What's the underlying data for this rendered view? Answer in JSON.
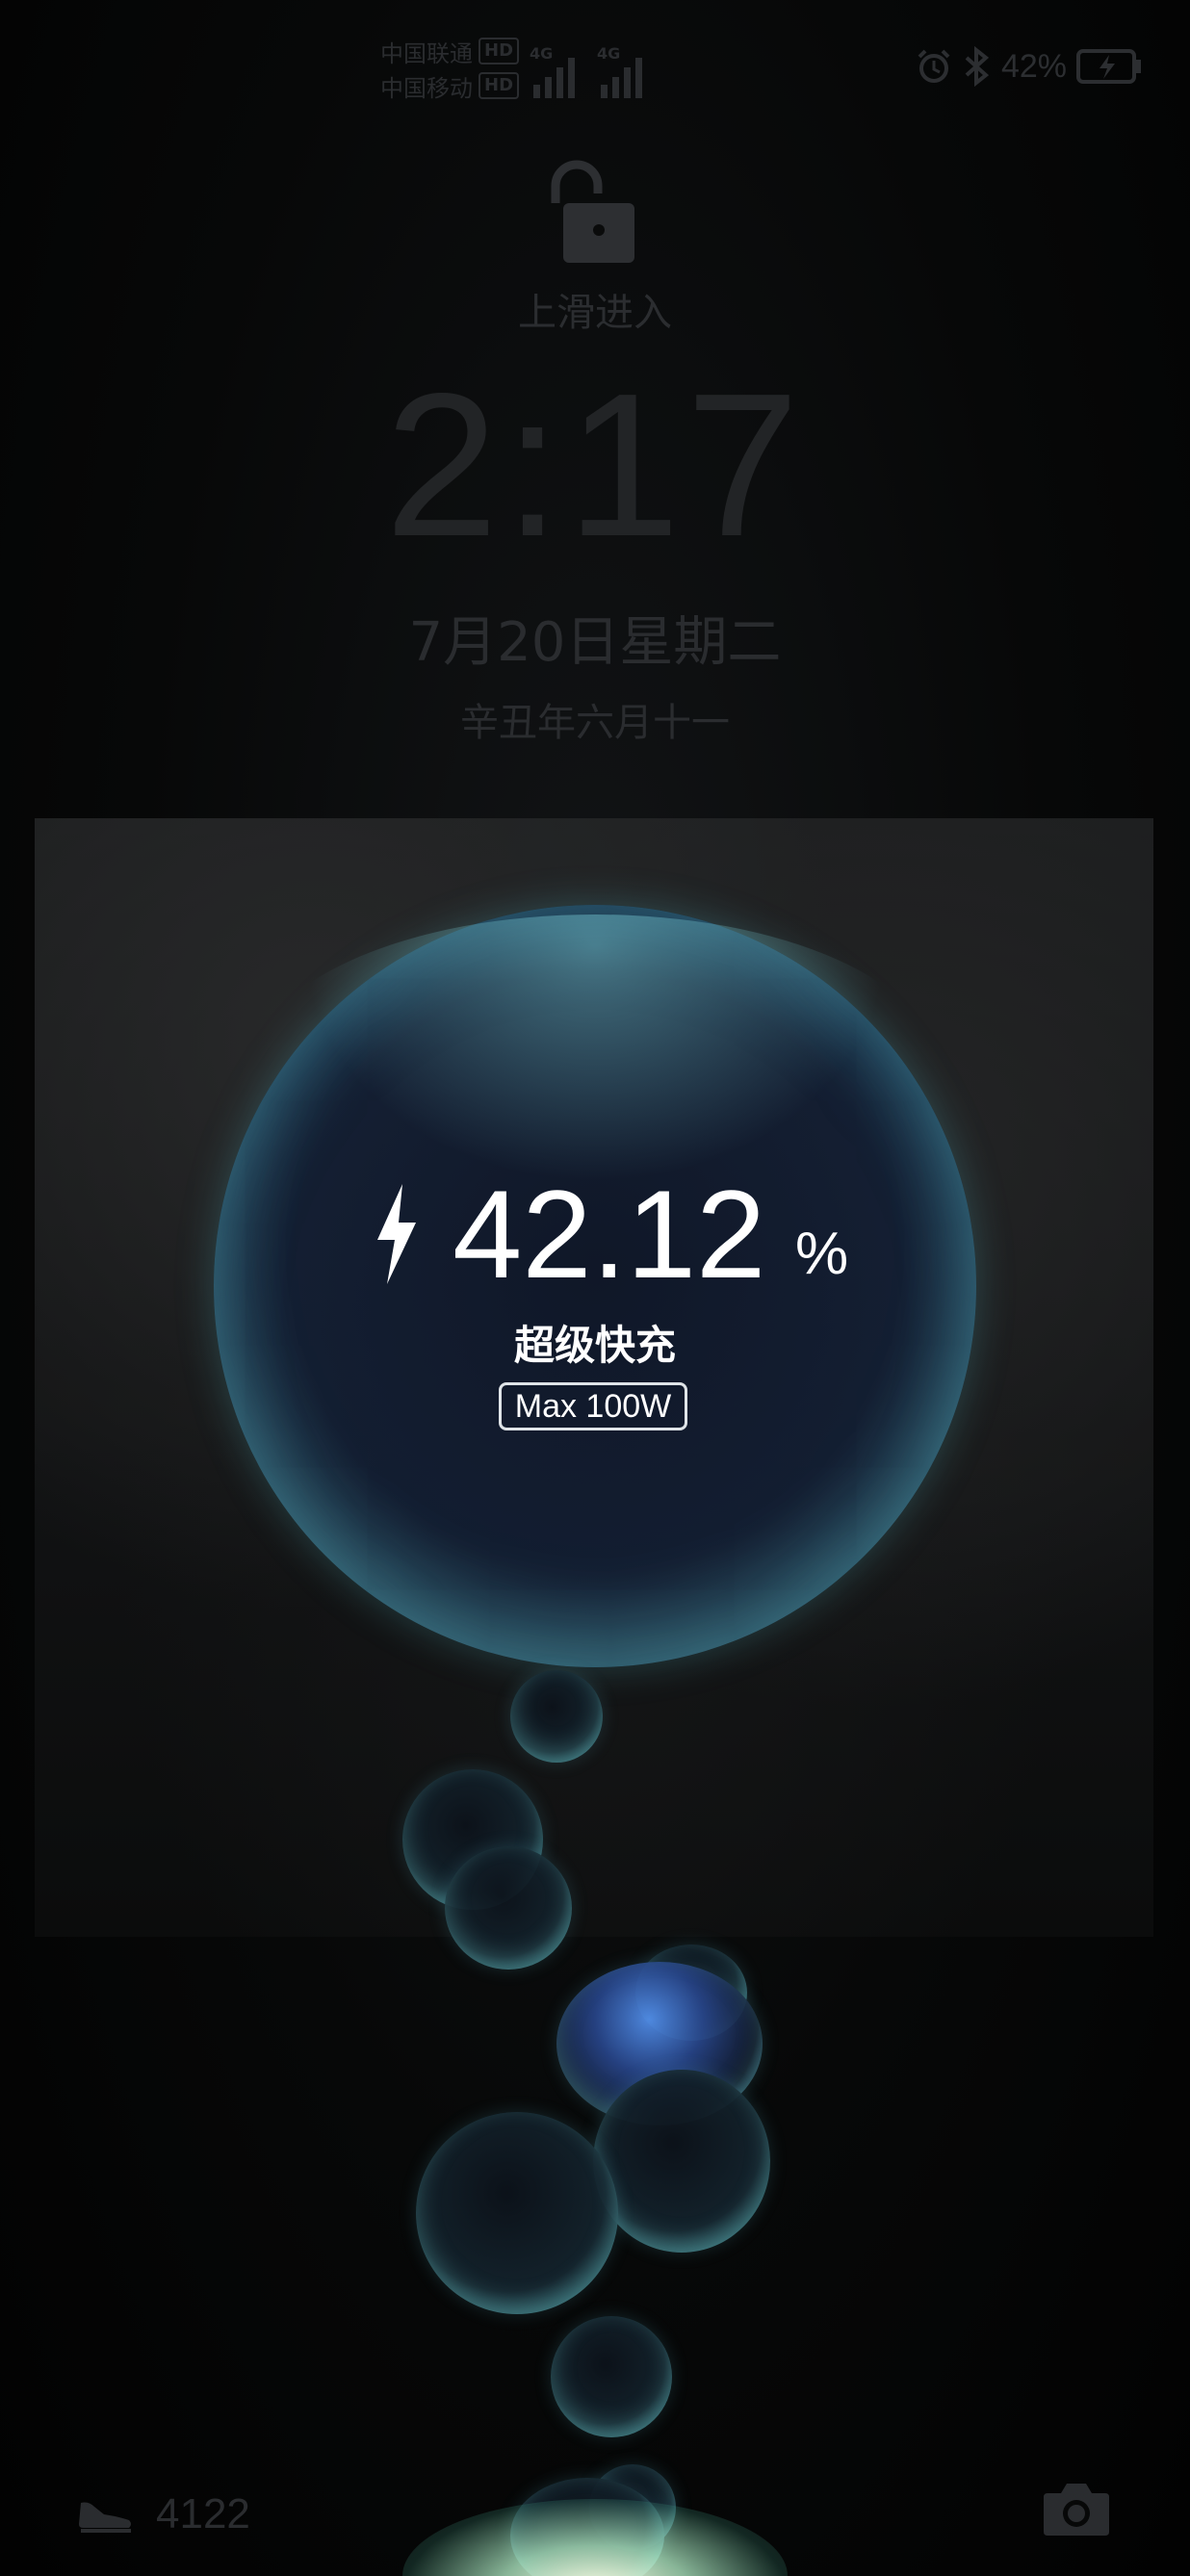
{
  "status_bar": {
    "carrier_1": "中国联通",
    "carrier_2": "中国移动",
    "hd_label": "HD",
    "network_1": "4G",
    "network_2": "4G",
    "battery_percent": "42%",
    "icons": [
      "alarm-icon",
      "bluetooth-icon",
      "battery-charging-icon"
    ]
  },
  "lock": {
    "icon": "unlock-icon",
    "hint": "上滑进入"
  },
  "clock": {
    "time": "2:17",
    "date": "7月20日星期二",
    "lunar": "辛丑年六月十一"
  },
  "charging": {
    "icon": "lightning-bolt-icon",
    "percent": "42.12",
    "percent_sign": "%",
    "mode": "超级快充",
    "max_power": "Max 100W",
    "accent_color": "#8fe3e2"
  },
  "bottom_bar": {
    "steps_icon": "shoe-icon",
    "steps": "4122",
    "camera_icon": "camera-icon"
  }
}
